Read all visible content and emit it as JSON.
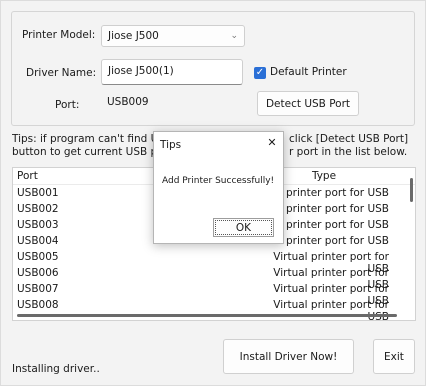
{
  "form": {
    "printer_model_label": "Printer Model:",
    "printer_model_value": "Jiose J500",
    "driver_name_label": "Driver Name:",
    "driver_name_value": "Jiose J500(1)",
    "port_label": "Port:",
    "port_value": "USB009",
    "default_printer_label": "Default Printer",
    "default_printer_checked": true,
    "detect_button": "Detect USB Port"
  },
  "tips": {
    "line1": "Tips: if program can't find US",
    "line1_right": "click [Detect USB Port]",
    "line2": "button to get current USB po",
    "line2_right": "r port in the list below."
  },
  "list": {
    "headers": {
      "port": "Port",
      "type": "Type"
    },
    "rows": [
      {
        "port": "USB001",
        "type": "l printer port for USB"
      },
      {
        "port": "USB002",
        "type": "l printer port for USB"
      },
      {
        "port": "USB003",
        "type": "l printer port for USB"
      },
      {
        "port": "USB004",
        "type": "l printer port for USB"
      },
      {
        "port": "USB005",
        "type": "Virtual printer port for USB"
      },
      {
        "port": "USB006",
        "type": "Virtual printer port for USB"
      },
      {
        "port": "USB007",
        "type": "Virtual printer port for USB"
      },
      {
        "port": "USB008",
        "type": "Virtual printer port for USB"
      }
    ]
  },
  "actions": {
    "install_button": "Install Driver Now!",
    "exit_button": "Exit"
  },
  "status": {
    "text": "Installing driver.."
  },
  "dialog": {
    "title": "Tips",
    "message": "Add Printer Successfully!",
    "ok_button": "OK",
    "close_glyph": "✕"
  },
  "icons": {
    "combo_chevron": "chevron-down-icon",
    "checkbox_mark": "checkmark-icon"
  },
  "colors": {
    "accent": "#2a6fd6"
  }
}
